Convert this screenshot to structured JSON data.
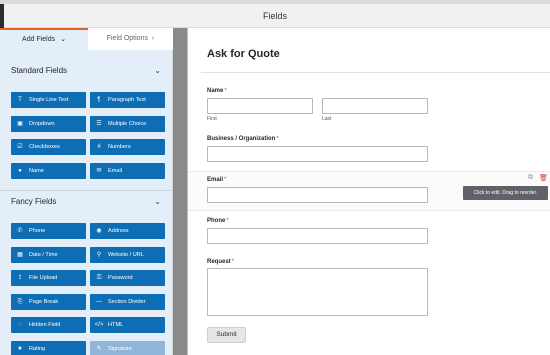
{
  "header": {
    "title": "Fields"
  },
  "tabs": {
    "add_fields": "Add Fields",
    "add_fields_chevron": "⌄",
    "field_options": "Field Options",
    "field_options_chevron": "›"
  },
  "sidebar": {
    "standard": {
      "heading": "Standard Fields",
      "chevron": "⌄",
      "buttons": [
        {
          "label": "Single Line Text",
          "icon": "T"
        },
        {
          "label": "Paragraph Text",
          "icon": "¶"
        },
        {
          "label": "Dropdown",
          "icon": "▣"
        },
        {
          "label": "Multiple Choice",
          "icon": "☰"
        },
        {
          "label": "Checkboxes",
          "icon": "☑"
        },
        {
          "label": "Numbers",
          "icon": "#"
        },
        {
          "label": "Name",
          "icon": "●"
        },
        {
          "label": "Email",
          "icon": "✉"
        }
      ]
    },
    "fancy": {
      "heading": "Fancy Fields",
      "chevron": "⌄",
      "buttons": [
        {
          "label": "Phone",
          "icon": "✆"
        },
        {
          "label": "Address",
          "icon": "◉"
        },
        {
          "label": "Date / Time",
          "icon": "▦"
        },
        {
          "label": "Website / URL",
          "icon": "⚲"
        },
        {
          "label": "File Upload",
          "icon": "⇪"
        },
        {
          "label": "Password",
          "icon": "⚿"
        },
        {
          "label": "Page Break",
          "icon": "⎘"
        },
        {
          "label": "Section Divider",
          "icon": "—"
        },
        {
          "label": "Hidden Field",
          "icon": "◌"
        },
        {
          "label": "HTML",
          "icon": "</>"
        },
        {
          "label": "Rating",
          "icon": "★"
        },
        {
          "label": "Signature",
          "icon": "✎"
        }
      ]
    }
  },
  "form": {
    "title": "Ask for Quote",
    "name_label": "Name",
    "first_sub": "First",
    "last_sub": "Last",
    "business_label": "Business / Organization",
    "email_label": "Email",
    "phone_label": "Phone",
    "request_label": "Request",
    "required_mark": "*",
    "submit_label": "Submit",
    "tooltip": "Click to edit. Drag to reorder.",
    "duplicate_icon": "⧉",
    "delete_icon": "🗑"
  },
  "colors": {
    "button_blue": "#0e6eb5",
    "sidebar_bg": "#e4eef9",
    "required": "#d63638",
    "tab_accent": "#e3642a"
  }
}
